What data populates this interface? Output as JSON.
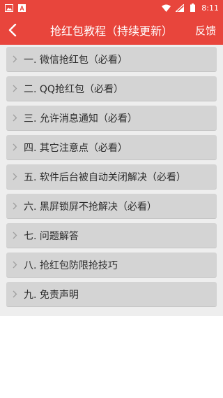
{
  "status_bar": {
    "time": "8:11",
    "left_icons": [
      "image-icon",
      "a-icon"
    ],
    "right_icons": [
      "wifi-icon",
      "cellular-icon",
      "battery-icon"
    ]
  },
  "app_bar": {
    "title": "抢红包教程（持续更新）",
    "feedback_label": "反馈",
    "back_icon": "back-chevron-icon"
  },
  "items": [
    {
      "label": "一. 微信抢红包（必看）"
    },
    {
      "label": "二. QQ抢红包（必看）"
    },
    {
      "label": "三. 允许消息通知（必看）"
    },
    {
      "label": "四. 其它注意点（必看）"
    },
    {
      "label": "五. 软件后台被自动关闭解决（必看）"
    },
    {
      "label": "六. 黑屏锁屏不抢解决（必看）"
    },
    {
      "label": "七. 问题解答"
    },
    {
      "label": "八. 抢红包防限抢技巧"
    },
    {
      "label": "九. 免责声明"
    }
  ],
  "colors": {
    "accent": "#e8453c",
    "item_bg": "#d4d4d4",
    "list_bg": "#eeeeee"
  }
}
